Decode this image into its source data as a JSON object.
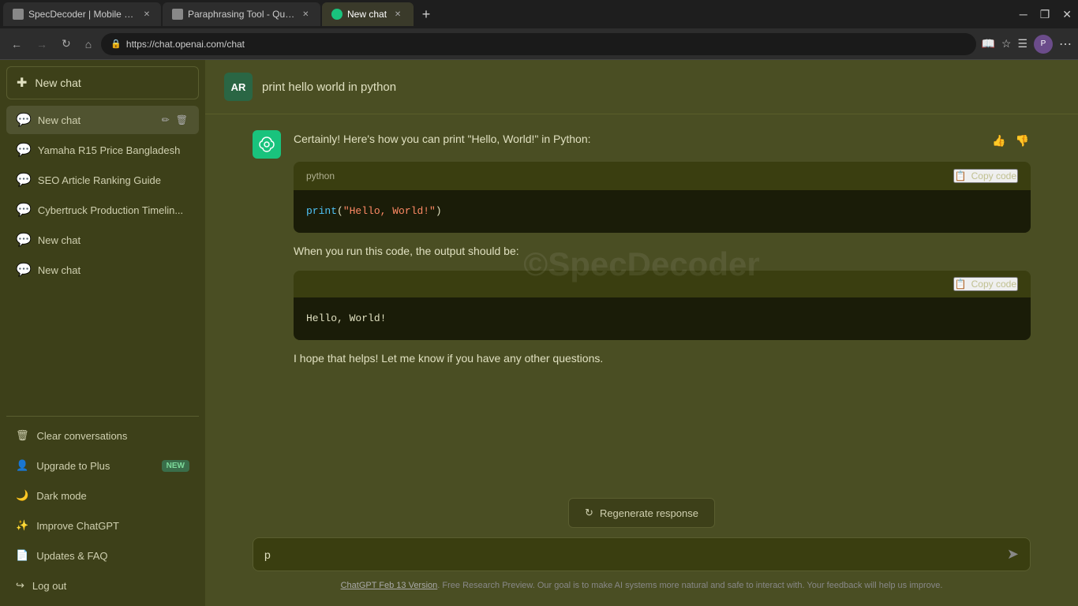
{
  "browser": {
    "tabs": [
      {
        "id": "tab1",
        "title": "SpecDecoder | Mobile Phone Pr...",
        "favicon_type": "normal",
        "active": false
      },
      {
        "id": "tab2",
        "title": "Paraphrasing Tool - QuillBot AI",
        "favicon_type": "normal",
        "active": false
      },
      {
        "id": "tab3",
        "title": "New chat",
        "favicon_type": "gpt",
        "active": true
      }
    ],
    "url": "https://chat.openai.com/chat"
  },
  "sidebar": {
    "new_chat_label": "New chat",
    "chat_items": [
      {
        "id": "c0",
        "label": "New chat",
        "active": true
      },
      {
        "id": "c1",
        "label": "Yamaha R15 Price Bangladesh"
      },
      {
        "id": "c2",
        "label": "SEO Article Ranking Guide"
      },
      {
        "id": "c3",
        "label": "Cybertruck Production Timelin..."
      },
      {
        "id": "c4",
        "label": "New chat"
      },
      {
        "id": "c5",
        "label": "New chat"
      }
    ],
    "bottom_items": [
      {
        "id": "b1",
        "icon": "🗑",
        "label": "Clear conversations",
        "badge": null
      },
      {
        "id": "b2",
        "icon": "👤",
        "label": "Upgrade to Plus",
        "badge": "NEW"
      },
      {
        "id": "b3",
        "icon": "🌙",
        "label": "Dark mode",
        "badge": null
      },
      {
        "id": "b4",
        "icon": "✨",
        "label": "Improve ChatGPT",
        "badge": null
      },
      {
        "id": "b5",
        "icon": "📄",
        "label": "Updates & FAQ",
        "badge": null
      },
      {
        "id": "b6",
        "icon": "↪",
        "label": "Log out",
        "badge": null
      }
    ]
  },
  "chat": {
    "user_initial": "AR",
    "user_query": "print hello world in python",
    "watermark": "©SpecDecoder",
    "assistant_intro": "Certainly! Here's how you can print \"Hello, World!\" in Python:",
    "code_block_1": {
      "lang": "python",
      "copy_label": "Copy code",
      "code": "print(\"Hello, World!\")"
    },
    "between_text": "When you run this code, the output should be:",
    "code_block_2": {
      "lang": "",
      "copy_label": "Copy code",
      "code": "Hello, World!"
    },
    "closing_text": "I hope that helps! Let me know if you have any other questions.",
    "regen_label": "Regenerate response",
    "input_value": "p",
    "footer_note_prefix": "",
    "footer_link": "ChatGPT Feb 13 Version",
    "footer_text": ". Free Research Preview. Our goal is to make AI systems more natural and safe to interact with. Your feedback will help us improve."
  }
}
